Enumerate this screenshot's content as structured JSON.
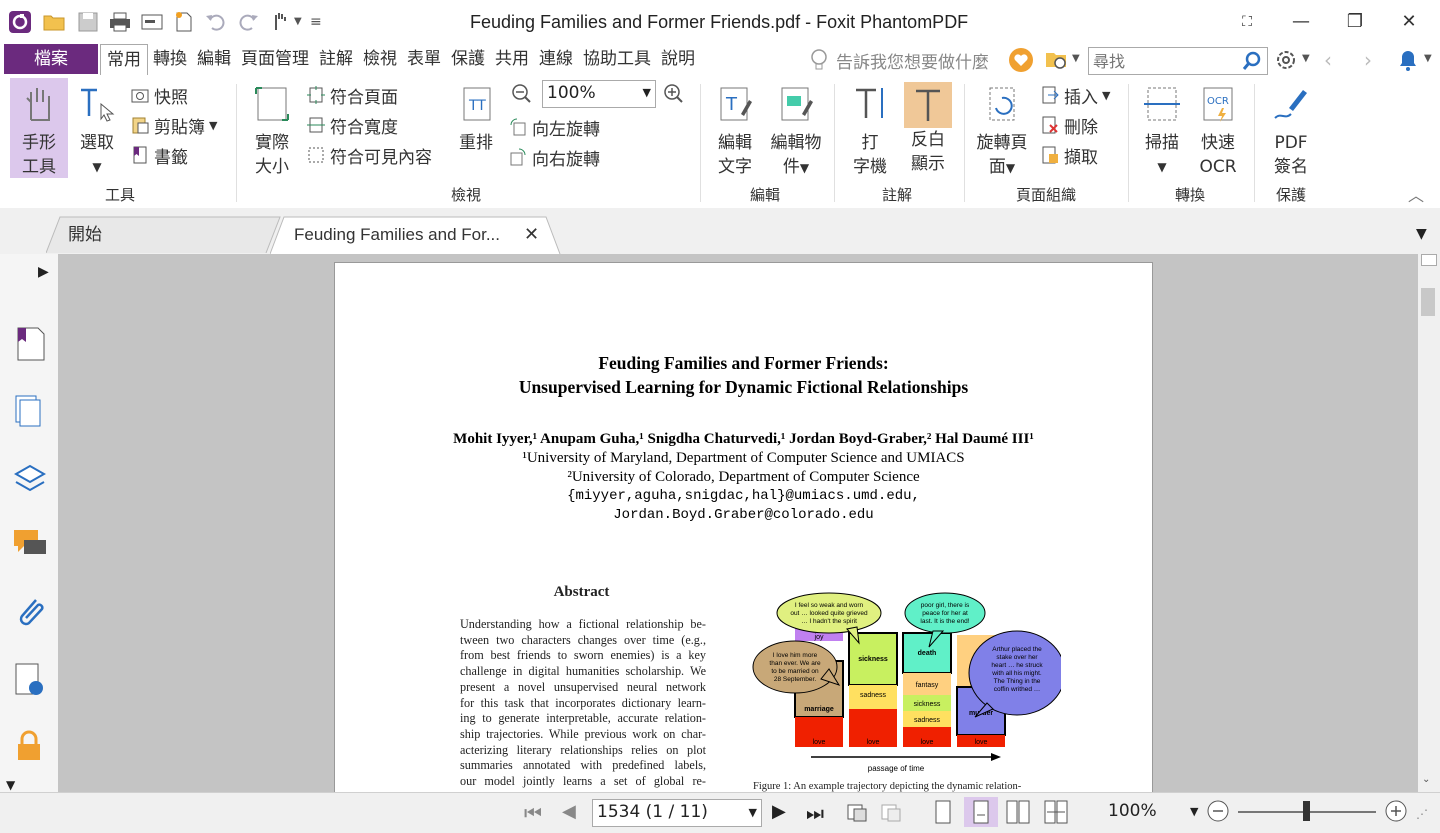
{
  "app": {
    "title": "Feuding Families and Former Friends.pdf - Foxit PhantomPDF"
  },
  "menu": {
    "file": "檔案",
    "tabs": [
      "常用",
      "轉換",
      "編輯",
      "頁面管理",
      "註解",
      "檢視",
      "表單",
      "保護",
      "共用",
      "連線",
      "協助工具",
      "說明"
    ],
    "tell_me": "告訴我您想要做什麼",
    "search_placeholder": "尋找"
  },
  "ribbon": {
    "tools": {
      "hand_l1": "手形",
      "hand_l2": "工具",
      "select": "選取",
      "snapshot": "快照",
      "clipboard": "剪貼簿",
      "bookmark": "書籤",
      "label": "工具"
    },
    "view": {
      "actual_l1": "實際",
      "actual_l2": "大小",
      "fit_page": "符合頁面",
      "fit_width": "符合寬度",
      "fit_visible": "符合可見內容",
      "reflow": "重排",
      "zoom": "100%",
      "rotate_left": "向左旋轉",
      "rotate_right": "向右旋轉",
      "label": "檢視"
    },
    "edit": {
      "edit_text_l1": "編輯",
      "edit_text_l2": "文字",
      "edit_obj_l1": "編輯物",
      "edit_obj_l2": "件",
      "label": "編輯"
    },
    "comment": {
      "typewriter_l1": "打",
      "typewriter_l2": "字機",
      "highlight_l1": "反白",
      "highlight_l2": "顯示",
      "label": "註解"
    },
    "pages": {
      "rotate_l1": "旋轉頁",
      "rotate_l2": "面",
      "insert": "插入",
      "delete": "刪除",
      "extract": "擷取",
      "label": "頁面組織"
    },
    "convert": {
      "scan": "掃描",
      "ocr_l1": "快速",
      "ocr_l2": "OCR",
      "label": "轉換"
    },
    "protect": {
      "sign_l1": "PDF",
      "sign_l2": "簽名",
      "label": "保護"
    }
  },
  "tabs": {
    "start": "開始",
    "doc": "Feuding Families and For..."
  },
  "paper": {
    "title1": "Feuding Families and Former Friends:",
    "title2": "Unsupervised Learning for Dynamic Fictional Relationships",
    "authors": "Mohit Iyyer,¹ Anupam Guha,¹ Snigdha Chaturvedi,¹ Jordan Boyd-Graber,² Hal Daumé III¹",
    "affil1": "¹University of Maryland, Department of Computer Science and UMIACS",
    "affil2": "²University of Colorado, Department of Computer Science",
    "email1": "{miyyer,aguha,snigdac,hal}@umiacs.umd.edu,",
    "email2": "Jordan.Boyd.Graber@colorado.edu",
    "abstract_title": "Abstract",
    "abstract_lines": [
      "Understanding how a fictional relationship be-",
      "tween two characters changes over time (e.g.,",
      "from best friends to sworn enemies) is a key",
      "challenge in digital humanities scholarship. We",
      "present a novel unsupervised neural network",
      "for this task that incorporates dictionary learn-",
      "ing to generate interpretable, accurate relation-",
      "ship trajectories. While previous work on char-",
      "acterizing literary relationships relies on plot",
      "summaries annotated with predefined labels,",
      "our model jointly learns a set of global re-"
    ],
    "figure": {
      "bubble1": [
        "I feel so weak and worn",
        "out … looked quite grieved",
        "… I hadn't the spirit"
      ],
      "bubble2": [
        "poor girl, there is",
        "peace for her at",
        "last. It is the end!"
      ],
      "bubble3": [
        "I love him more",
        "than ever. We are",
        "to be married on",
        "28 September."
      ],
      "bubble4": [
        "Arthur placed the",
        "stake over her",
        "heart … he struck",
        "with all his might.",
        "The Thing in the",
        "coffin writhed …"
      ],
      "col1": [
        "joy",
        "marriage",
        "love"
      ],
      "col2": [
        "sickness",
        "sadness",
        "love"
      ],
      "col3": [
        "death",
        "fantasy",
        "sickness",
        "sadness",
        "love"
      ],
      "col4": [
        "murder",
        "love"
      ],
      "axis": "passage of time"
    },
    "caption": "Figure 1:  An example trajectory depicting the dynamic relation-"
  },
  "status": {
    "page": "1534 (1 / 11)",
    "zoom": "100%"
  },
  "colors": {
    "accent": "#6b2a7e",
    "highlight_bg": "#f0c898",
    "active_tool": "#dcc8ec"
  }
}
